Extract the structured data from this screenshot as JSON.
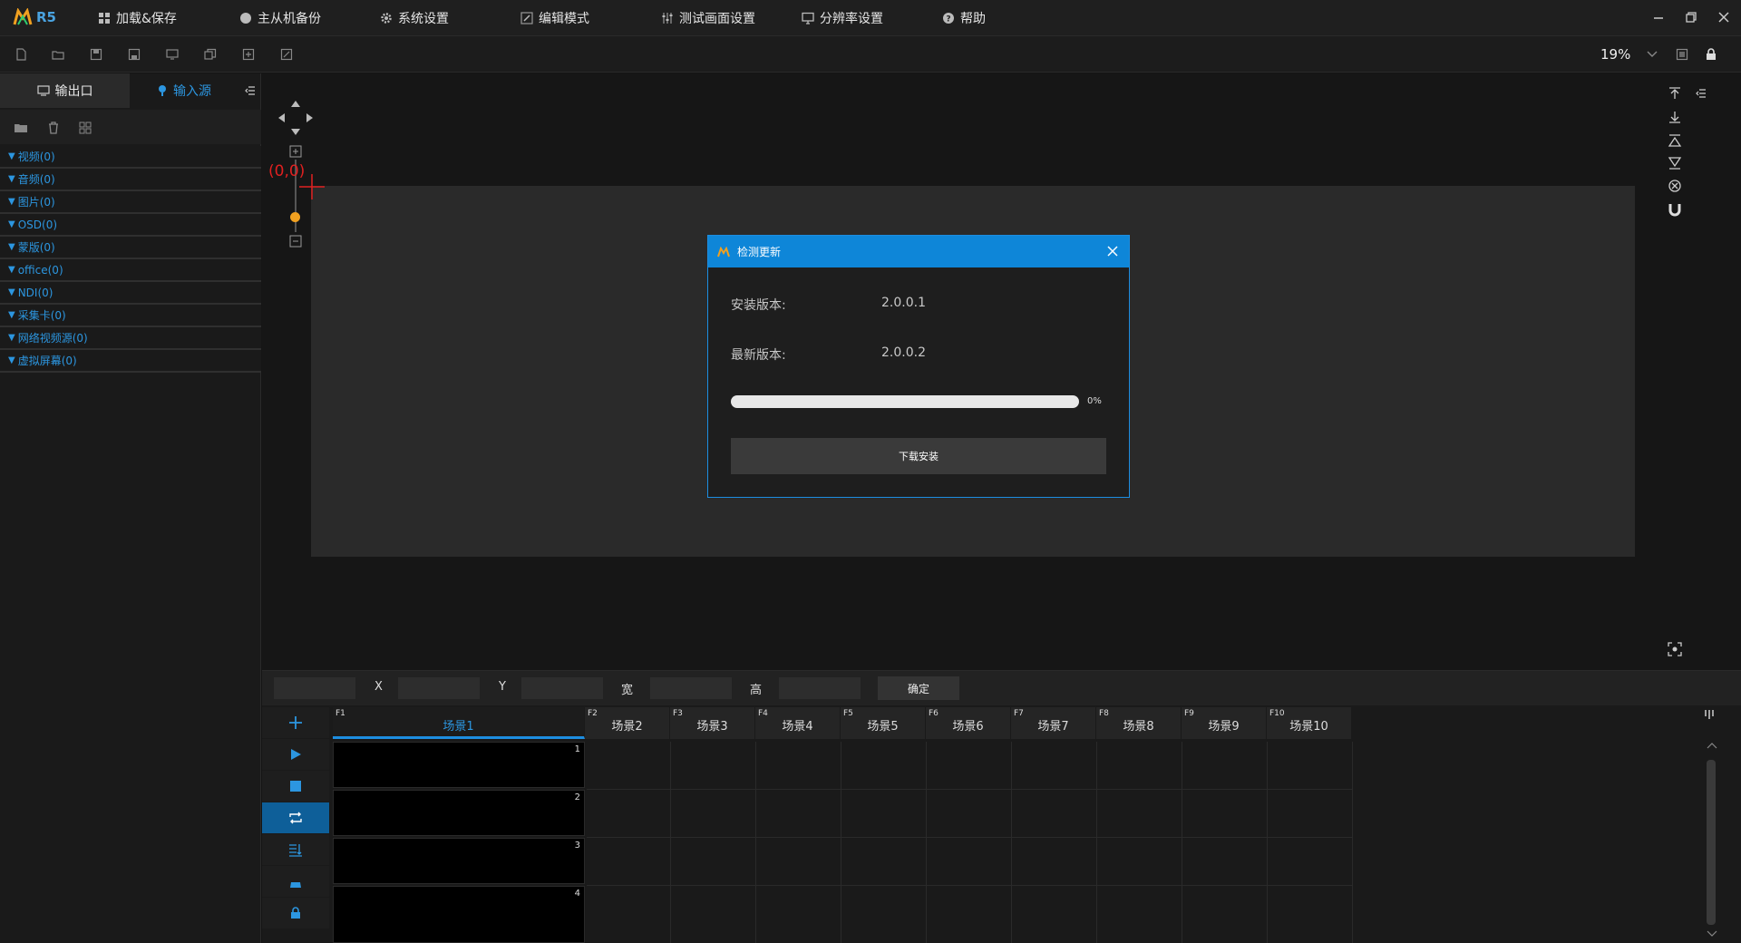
{
  "app": {
    "logo_text": "R5"
  },
  "menu": [
    {
      "label": "加载&保存",
      "icon": "grid-icon"
    },
    {
      "label": "主从机备份",
      "icon": "circle-icon"
    },
    {
      "label": "系统设置",
      "icon": "gear-icon"
    },
    {
      "label": "编辑模式",
      "icon": "edit-icon"
    },
    {
      "label": "测试画面设置",
      "icon": "sliders-icon"
    },
    {
      "label": "分辨率设置",
      "icon": "monitor-icon"
    },
    {
      "label": "帮助",
      "icon": "help-icon"
    }
  ],
  "toolbar": {
    "zoom": "19%"
  },
  "left_panel": {
    "tab_output": "输出口",
    "tab_input": "输入源",
    "sources": [
      "视频(0)",
      "音频(0)",
      "图片(0)",
      "OSD(0)",
      "蒙版(0)",
      "office(0)",
      "NDI(0)",
      "采集卡(0)",
      "网络视频源(0)",
      "虚拟屏幕(0)"
    ]
  },
  "canvas": {
    "origin_label": "(0,0)"
  },
  "dialog": {
    "title": "检测更新",
    "installed_label": "安装版本:",
    "installed_value": "2.0.0.1",
    "latest_label": "最新版本:",
    "latest_value": "2.0.0.2",
    "progress": 0,
    "progress_text": "0%",
    "button_label": "下载安装"
  },
  "coord_bar": {
    "x_label": "X",
    "y_label": "Y",
    "w_label": "宽",
    "h_label": "高",
    "ok_label": "确定"
  },
  "scenes": [
    {
      "key": "F1",
      "label": "场景1"
    },
    {
      "key": "F2",
      "label": "场景2"
    },
    {
      "key": "F3",
      "label": "场景3"
    },
    {
      "key": "F4",
      "label": "场景4"
    },
    {
      "key": "F5",
      "label": "场景5"
    },
    {
      "key": "F6",
      "label": "场景6"
    },
    {
      "key": "F7",
      "label": "场景7"
    },
    {
      "key": "F8",
      "label": "场景8"
    },
    {
      "key": "F9",
      "label": "场景9"
    },
    {
      "key": "F10",
      "label": "场景10"
    }
  ],
  "scene_rows": [
    "1",
    "2",
    "3",
    "4"
  ],
  "colors": {
    "accent": "#0e86d8",
    "origin": "#e02020",
    "handle": "#f0a020"
  }
}
